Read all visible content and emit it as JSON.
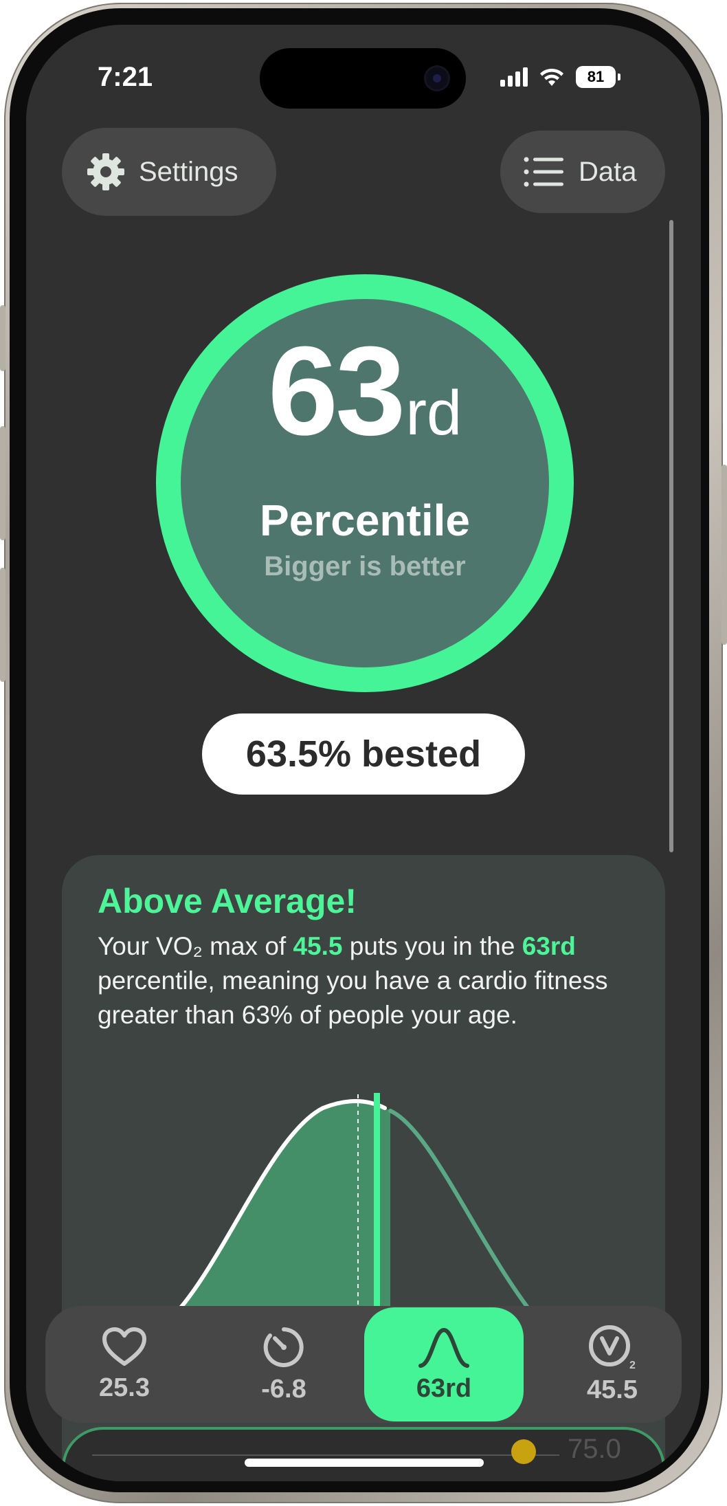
{
  "status_bar": {
    "time": "7:21",
    "battery": "81"
  },
  "header": {
    "settings_label": "Settings",
    "data_label": "Data"
  },
  "score": {
    "rank": "63",
    "suffix": "rd",
    "label": "Percentile",
    "subtitle": "Bigger is better",
    "progress": 0.635,
    "accent": "#44f497"
  },
  "bested": "63.5% bested",
  "card": {
    "title": "Above Average!",
    "text_1": "Your VO₂ max of ",
    "vo2": "45.5",
    "text_2": " puts you in the ",
    "percentile": "63rd",
    "text_3": " percentile, meaning you have a cardio fitness greater than 63% of people your age."
  },
  "tabs": [
    {
      "label": "25.3",
      "icon": "heart-icon"
    },
    {
      "label": "-6.8",
      "icon": "stopwatch-icon"
    },
    {
      "label": "63rd",
      "icon": "bell-curve-icon"
    },
    {
      "label": "45.5",
      "icon": "vo2-icon"
    }
  ],
  "peek": {
    "value": "75.0"
  }
}
